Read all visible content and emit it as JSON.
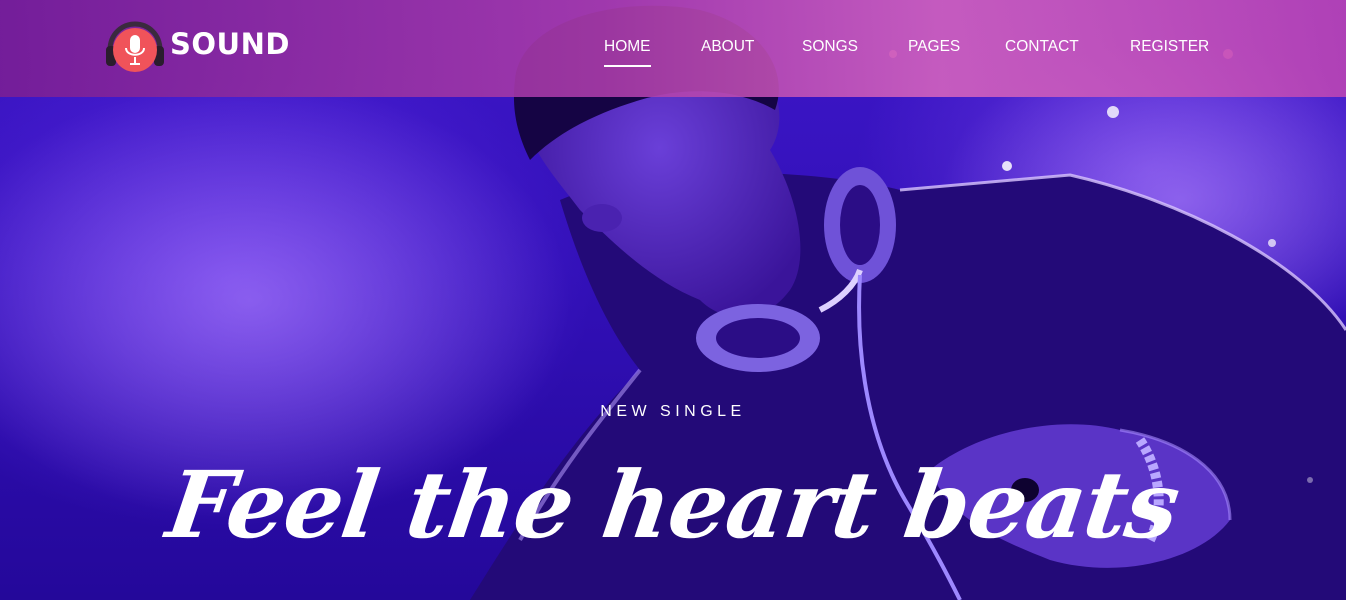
{
  "brand": {
    "name": "SOUND",
    "logo_icon": "microphone-headphones-icon"
  },
  "nav": {
    "items": [
      {
        "label": "HOME",
        "active": true
      },
      {
        "label": "ABOUT",
        "active": false
      },
      {
        "label": "SONGS",
        "active": false
      },
      {
        "label": "PAGES",
        "active": false
      },
      {
        "label": "CONTACT",
        "active": false
      },
      {
        "label": "REGISTER",
        "active": false
      }
    ]
  },
  "hero": {
    "eyebrow": "NEW SINGLE",
    "headline": "Feel the heart beats"
  },
  "colors": {
    "hero_purple": "#3412bb",
    "nav_pink": "#d466bf",
    "logo_red": "#f0535a",
    "text": "#ffffff"
  }
}
